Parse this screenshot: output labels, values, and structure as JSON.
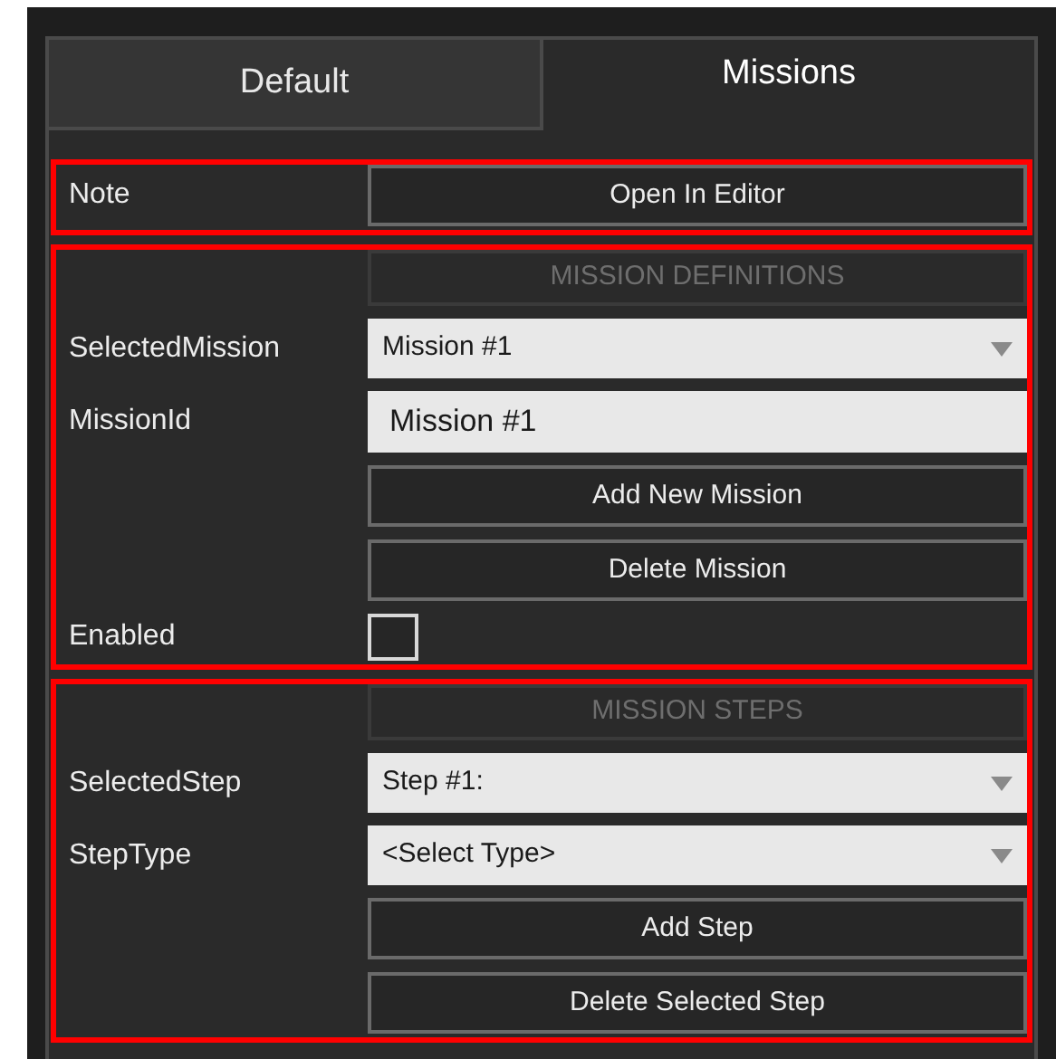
{
  "tabs": [
    {
      "label": "Default",
      "selected": false
    },
    {
      "label": "Missions",
      "selected": true
    }
  ],
  "sections": [
    {
      "rows": [
        {
          "kind": "button",
          "label": "Note",
          "text": "Open In Editor"
        }
      ]
    },
    {
      "rows": [
        {
          "kind": "header",
          "text": "MISSION DEFINITIONS"
        },
        {
          "kind": "combo",
          "label": "SelectedMission",
          "value": "Mission #1"
        },
        {
          "kind": "text",
          "label": "MissionId",
          "value": "Mission #1"
        },
        {
          "kind": "button",
          "text": "Add New Mission"
        },
        {
          "kind": "button",
          "text": "Delete Mission"
        },
        {
          "kind": "checkbox",
          "label": "Enabled",
          "checked": false
        }
      ]
    },
    {
      "rows": [
        {
          "kind": "header",
          "text": "MISSION STEPS"
        },
        {
          "kind": "combo",
          "label": "SelectedStep",
          "value": "Step #1:"
        },
        {
          "kind": "combo",
          "label": "StepType",
          "value": "<Select Type>"
        },
        {
          "kind": "button",
          "text": "Add Step"
        },
        {
          "kind": "button",
          "text": "Delete Selected Step"
        }
      ]
    }
  ]
}
